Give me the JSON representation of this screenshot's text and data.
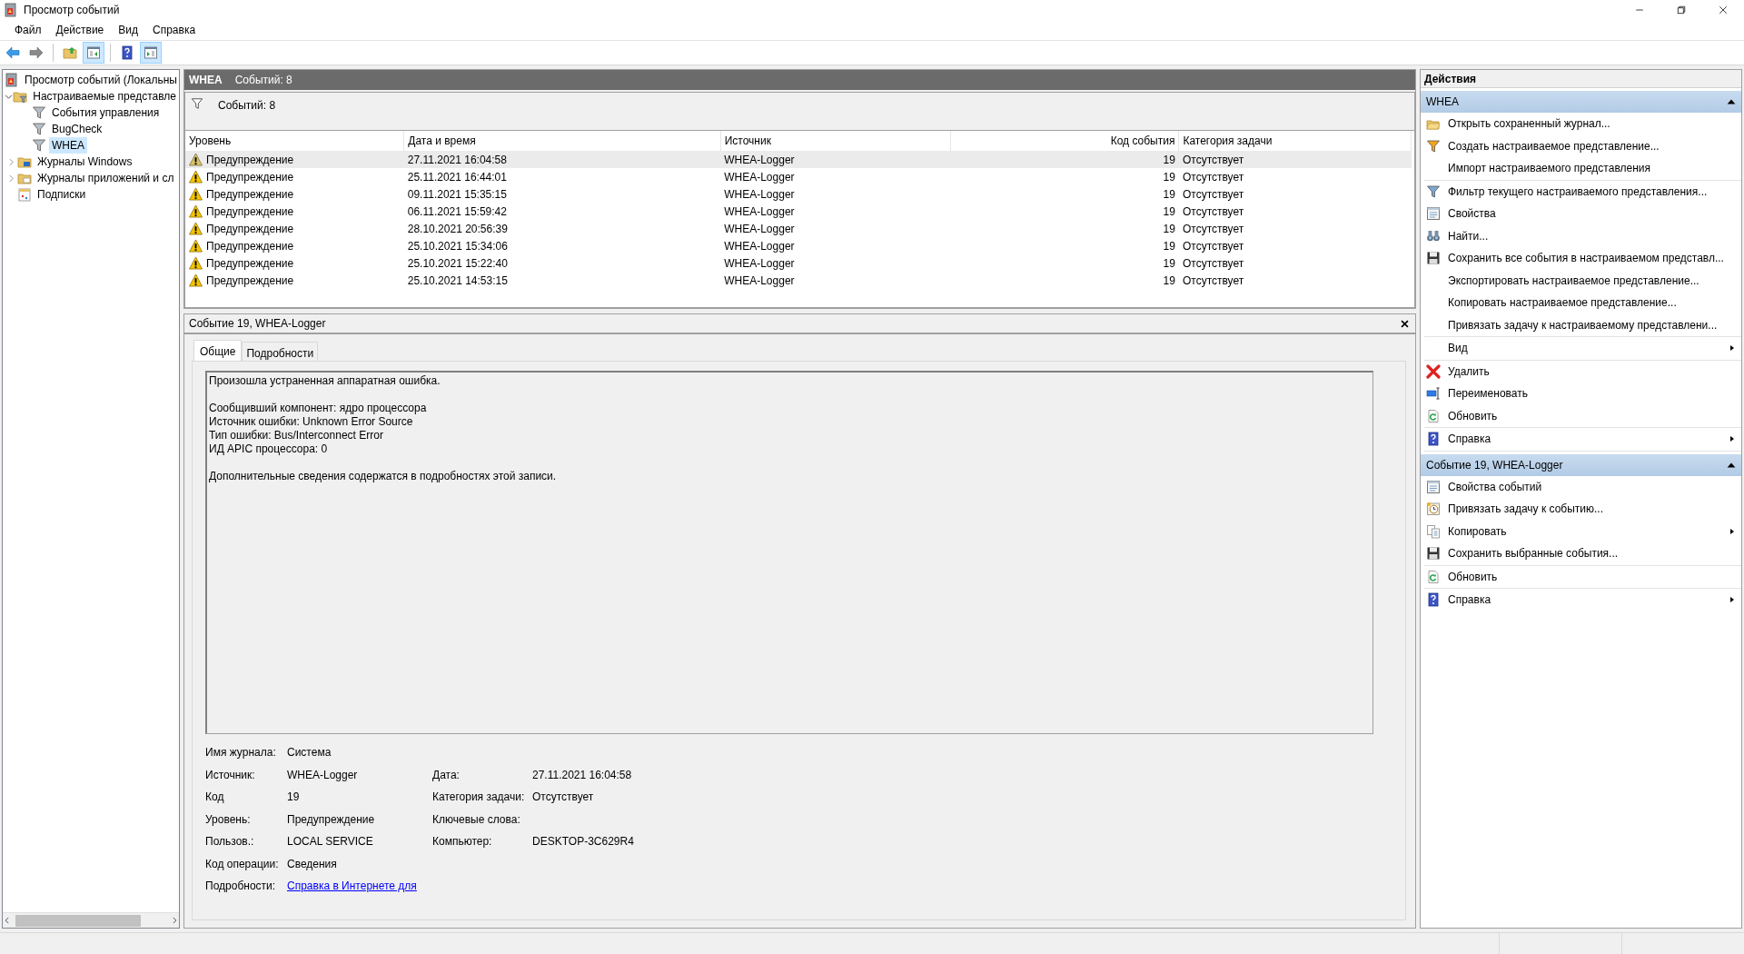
{
  "window": {
    "title": "Просмотр событий"
  },
  "menu": [
    {
      "label": "Файл"
    },
    {
      "label": "Действие"
    },
    {
      "label": "Вид"
    },
    {
      "label": "Справка"
    }
  ],
  "toolbar": [
    {
      "kind": "back",
      "pressed": false
    },
    {
      "kind": "forward",
      "pressed": false
    },
    {
      "kind": "separator"
    },
    {
      "kind": "up",
      "pressed": false
    },
    {
      "kind": "console-tree",
      "pressed": true
    },
    {
      "kind": "separator"
    },
    {
      "kind": "help",
      "pressed": false
    },
    {
      "kind": "action-pane",
      "pressed": true
    }
  ],
  "tree": [
    {
      "label": "Просмотр событий (Локальны",
      "kind": "viewer",
      "selected": false,
      "children": [
        {
          "label": "Настраиваемые представле",
          "kind": "folder-funnel",
          "expanded": true,
          "selected": false,
          "children": [
            {
              "label": "События управления",
              "kind": "funnel",
              "selected": false
            },
            {
              "label": "BugCheck",
              "kind": "funnel",
              "selected": false
            },
            {
              "label": "WHEA",
              "kind": "funnel",
              "selected": true
            }
          ]
        },
        {
          "label": "Журналы Windows",
          "kind": "folder-logs",
          "expanded": false,
          "selected": false
        },
        {
          "label": "Журналы приложений и сл",
          "kind": "folder-apps",
          "expanded": false,
          "selected": false
        },
        {
          "label": "Подписки",
          "kind": "subscriptions",
          "selected": false
        }
      ]
    }
  ],
  "view_header": {
    "title": "WHEA",
    "count": "Событий: 8"
  },
  "filter_info": "Событий: 8",
  "table": {
    "columns": [
      "Уровень",
      "Дата и время",
      "Источник",
      "Код события",
      "Категория задачи"
    ],
    "rows": [
      {
        "kind": "warning",
        "selected": true,
        "cells": [
          "Предупреждение",
          "27.11.2021 16:04:58",
          "WHEA-Logger",
          "19",
          "Отсутствует"
        ]
      },
      {
        "kind": "warning",
        "selected": false,
        "cells": [
          "Предупреждение",
          "25.11.2021 16:44:01",
          "WHEA-Logger",
          "19",
          "Отсутствует"
        ]
      },
      {
        "kind": "warning",
        "selected": false,
        "cells": [
          "Предупреждение",
          "09.11.2021 15:35:15",
          "WHEA-Logger",
          "19",
          "Отсутствует"
        ]
      },
      {
        "kind": "warning",
        "selected": false,
        "cells": [
          "Предупреждение",
          "06.11.2021 15:59:42",
          "WHEA-Logger",
          "19",
          "Отсутствует"
        ]
      },
      {
        "kind": "warning",
        "selected": false,
        "cells": [
          "Предупреждение",
          "28.10.2021 20:56:39",
          "WHEA-Logger",
          "19",
          "Отсутствует"
        ]
      },
      {
        "kind": "warning",
        "selected": false,
        "cells": [
          "Предупреждение",
          "25.10.2021 15:34:06",
          "WHEA-Logger",
          "19",
          "Отсутствует"
        ]
      },
      {
        "kind": "warning",
        "selected": false,
        "cells": [
          "Предупреждение",
          "25.10.2021 15:22:40",
          "WHEA-Logger",
          "19",
          "Отсутствует"
        ]
      },
      {
        "kind": "warning",
        "selected": false,
        "cells": [
          "Предупреждение",
          "25.10.2021 14:53:15",
          "WHEA-Logger",
          "19",
          "Отсутствует"
        ]
      }
    ]
  },
  "detail": {
    "title": "Событие 19, WHEA-Logger",
    "tabs": [
      {
        "label": "Общие",
        "selected": true
      },
      {
        "label": "Подробности",
        "selected": false
      }
    ],
    "message": "Произошла устраненная аппаратная ошибка.\n\nСообщивший компонент: ядро процессора\nИсточник ошибки: Unknown Error Source\nТип ошибки: Bus/Interconnect Error\nИД APIC процессора: 0\n\nДополнительные сведения содержатся в подробностях этой записи.",
    "fields": [
      [
        {
          "label": "Имя журнала:",
          "value": "Система"
        }
      ],
      [
        {
          "label": "Источник:",
          "value": "WHEA-Logger"
        },
        {
          "label": "Дата:",
          "value": "27.11.2021 16:04:58"
        }
      ],
      [
        {
          "label": "Код",
          "value": "19"
        },
        {
          "label": "Категория задачи:",
          "value": "Отсутствует"
        }
      ],
      [
        {
          "label": "Уровень:",
          "value": "Предупреждение"
        },
        {
          "label": "Ключевые слова:"
        }
      ],
      [
        {
          "label": "Пользов.:",
          "value": "LOCAL SERVICE"
        },
        {
          "label": "Компьютер:",
          "value": "DESKTOP-3C629R4"
        }
      ],
      [
        {
          "label": "Код операции:",
          "value": "Сведения"
        }
      ],
      [
        {
          "label": "Подробности:",
          "value": "Справка в Интернете для ",
          "kind": "link"
        }
      ]
    ]
  },
  "actions": {
    "title": "Действия",
    "sections": [
      {
        "title": "WHEA",
        "expanded": true,
        "groups": [
          [
            {
              "label": "Открыть сохраненный журнал...",
              "kind": "open-log",
              "submenu": false
            },
            {
              "label": "Создать настраиваемое представление...",
              "kind": "create-view",
              "submenu": false
            },
            {
              "label": "Импорт настраиваемого представления",
              "kind": "plain",
              "submenu": false
            }
          ],
          [
            {
              "label": "Фильтр текущего настраиваемого представления...",
              "kind": "filter",
              "submenu": false
            },
            {
              "label": "Свойства",
              "kind": "properties",
              "submenu": false
            },
            {
              "label": "Найти...",
              "kind": "find",
              "submenu": false
            },
            {
              "label": "Сохранить все события в настраиваемом представл...",
              "kind": "save",
              "submenu": false
            },
            {
              "label": "Экспортировать настраиваемое представление...",
              "kind": "plain",
              "submenu": false
            },
            {
              "label": "Копировать настраиваемое представление...",
              "kind": "plain",
              "submenu": false
            },
            {
              "label": "Привязать задачу к настраиваемому представлени...",
              "kind": "plain",
              "submenu": false
            }
          ],
          [
            {
              "label": "Вид",
              "kind": "plain",
              "submenu": true
            }
          ],
          [
            {
              "label": "Удалить",
              "kind": "delete",
              "submenu": false
            },
            {
              "label": "Переименовать",
              "kind": "rename",
              "submenu": false
            },
            {
              "label": "Обновить",
              "kind": "refresh",
              "submenu": false
            }
          ],
          [
            {
              "label": "Справка",
              "kind": "help",
              "submenu": true
            }
          ]
        ]
      },
      {
        "title": "Событие 19, WHEA-Logger",
        "expanded": true,
        "groups": [
          [
            {
              "label": "Свойства событий",
              "kind": "properties",
              "submenu": false
            },
            {
              "label": "Привязать задачу к событию...",
              "kind": "attach-task",
              "submenu": false
            },
            {
              "label": "Копировать",
              "kind": "copy",
              "submenu": true
            },
            {
              "label": "Сохранить выбранные события...",
              "kind": "save",
              "submenu": false
            }
          ],
          [
            {
              "label": "Обновить",
              "kind": "refresh",
              "submenu": false
            }
          ],
          [
            {
              "label": "Справка",
              "kind": "help",
              "submenu": true
            }
          ]
        ]
      }
    ]
  }
}
